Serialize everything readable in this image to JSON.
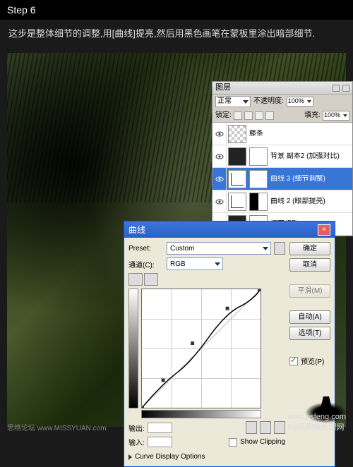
{
  "step_label": "Step 6",
  "description": "这步是整体细节的调整,用[曲线]提亮,然后用黑色画笔在蒙板里涂出暗部细节.",
  "watermark_left": "思络论坛  www.MISSYUAN.com",
  "watermark_right": "www.psfeng.com",
  "watermark_brand": "PS风图像处理网",
  "layers_panel": {
    "title": "图层",
    "blend_mode": "正常",
    "opacity_label": "不透明度:",
    "opacity_value": "100%",
    "lock_label": "锁定:",
    "fill_label": "填充:",
    "fill_value": "100%",
    "layers": [
      {
        "name": "藤条"
      },
      {
        "name": "背景 副本2 (加强对比)"
      },
      {
        "name": "曲线 3 (细节调整)"
      },
      {
        "name": "曲线 2 (眼部提亮)"
      },
      {
        "name": "细节修改"
      }
    ]
  },
  "curves": {
    "title": "曲线",
    "preset_label": "Preset:",
    "preset_value": "Custom",
    "channel_label": "通道(C):",
    "channel_value": "RGB",
    "output_label": "输出:",
    "input_label": "输入:",
    "show_clipping": "Show Clipping",
    "curve_display": "Curve Display Options",
    "buttons": {
      "ok": "确定",
      "cancel": "取消",
      "smooth": "平滑(M)",
      "auto": "自动(A)",
      "options": "选项(T)",
      "preview": "预览(P)"
    }
  },
  "chart_data": {
    "type": "line",
    "title": "曲线",
    "xlabel": "输入",
    "ylabel": "输出",
    "xlim": [
      0,
      255
    ],
    "ylim": [
      0,
      255
    ],
    "series": [
      {
        "name": "RGB",
        "x": [
          0,
          45,
          110,
          185,
          255
        ],
        "values": [
          0,
          60,
          140,
          215,
          255
        ]
      }
    ]
  }
}
